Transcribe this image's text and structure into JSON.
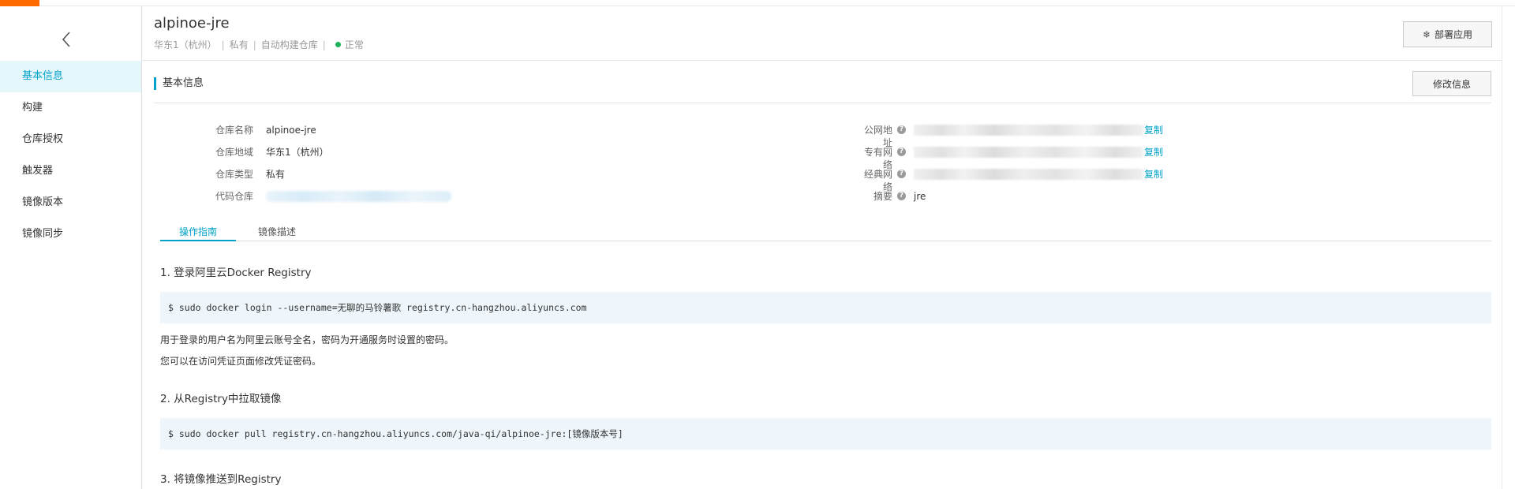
{
  "colors": {
    "accent": "#00a2ca",
    "brand": "#ff6a00",
    "status_ok": "#1cb35b"
  },
  "sidebar": {
    "back_icon": "chevron-left-icon",
    "items": [
      {
        "label": "基本信息",
        "active": true
      },
      {
        "label": "构建",
        "active": false
      },
      {
        "label": "仓库授权",
        "active": false
      },
      {
        "label": "触发器",
        "active": false
      },
      {
        "label": "镜像版本",
        "active": false
      },
      {
        "label": "镜像同步",
        "active": false
      }
    ]
  },
  "header": {
    "title": "alpinoe-jre",
    "region": "华东1（杭州）",
    "visibility": "私有",
    "build_type": "自动构建仓库",
    "status": "正常",
    "deploy_label": "部署应用",
    "deploy_icon": "cluster-icon"
  },
  "basic_info": {
    "section_title": "基本信息",
    "edit_label": "修改信息",
    "left": [
      {
        "label": "仓库名称",
        "value": "alpinoe-jre"
      },
      {
        "label": "仓库地域",
        "value": "华东1（杭州）"
      },
      {
        "label": "仓库类型",
        "value": "私有"
      },
      {
        "label": "代码仓库",
        "value": ""
      }
    ],
    "right": [
      {
        "label": "公网地址",
        "copy": "复制"
      },
      {
        "label": "专有网络",
        "copy": "复制"
      },
      {
        "label": "经典网络",
        "copy": "复制"
      },
      {
        "label": "摘要",
        "value": "jre"
      }
    ],
    "help_icon": "question-circle-icon"
  },
  "tabs": [
    {
      "label": "操作指南",
      "active": true
    },
    {
      "label": "镜像描述",
      "active": false
    }
  ],
  "guide": {
    "step1": "1. 登录阿里云Docker Registry",
    "cmd1": "$ sudo docker login --username=无聊的马铃薯歌 registry.cn-hangzhou.aliyuncs.com",
    "note1": "用于登录的用户名为阿里云账号全名，密码为开通服务时设置的密码。",
    "note2": "您可以在访问凭证页面修改凭证密码。",
    "step2": "2. 从Registry中拉取镜像",
    "cmd2": "$ sudo docker pull registry.cn-hangzhou.aliyuncs.com/java-qi/alpinoe-jre:[镜像版本号]",
    "step3": "3. 将镜像推送到Registry"
  }
}
